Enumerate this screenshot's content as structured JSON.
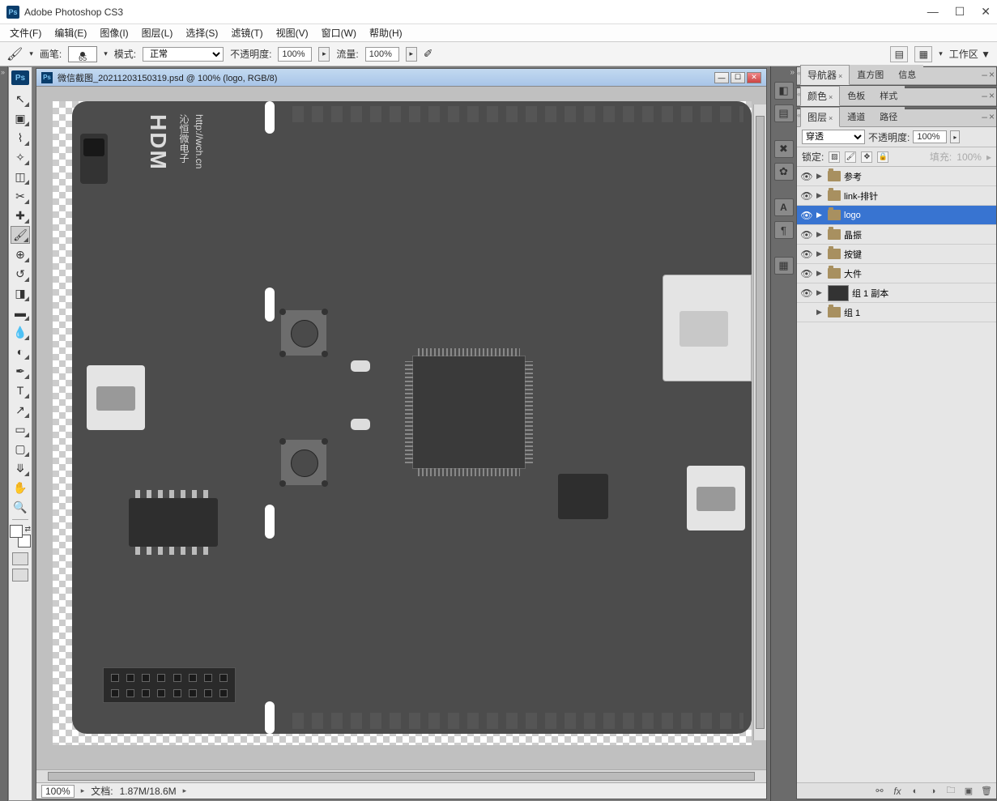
{
  "app": {
    "title": "Adobe Photoshop CS3"
  },
  "menus": [
    "文件(F)",
    "编辑(E)",
    "图像(I)",
    "图层(L)",
    "选择(S)",
    "滤镜(T)",
    "视图(V)",
    "窗口(W)",
    "帮助(H)"
  ],
  "options": {
    "brush_label": "画笔:",
    "brush_size": "65",
    "mode_label": "模式:",
    "mode_value": "正常",
    "opacity_label": "不透明度:",
    "opacity_value": "100%",
    "flow_label": "流量:",
    "flow_value": "100%",
    "workspace_label": "工作区 ▼"
  },
  "document": {
    "title": "微信截图_20211203150319.psd @ 100% (logo, RGB/8)",
    "zoom": "100%",
    "status_label": "文档:",
    "status_value": "1.87M/18.6M",
    "pcb_logo": "HDM",
    "pcb_sub": "沁恒微电子",
    "pcb_url": "http://wch.cn"
  },
  "nav_panel": {
    "tabs": [
      "导航器",
      "直方图",
      "信息"
    ]
  },
  "color_panel": {
    "tabs": [
      "颜色",
      "色板",
      "样式"
    ]
  },
  "layers_panel": {
    "tabs": [
      "图层",
      "通道",
      "路径"
    ],
    "blend_label": "",
    "blend_value": "穿透",
    "opacity_label": "不透明度:",
    "opacity_value": "100%",
    "lock_label": "锁定:",
    "fill_label": "填充:",
    "fill_value": "100%",
    "layers": [
      {
        "name": "参考",
        "type": "folder",
        "visible": true,
        "expanded": false,
        "selected": false
      },
      {
        "name": "link-排针",
        "type": "folder",
        "visible": true,
        "expanded": false,
        "selected": false
      },
      {
        "name": "logo",
        "type": "folder",
        "visible": true,
        "expanded": false,
        "selected": true
      },
      {
        "name": "晶振",
        "type": "folder",
        "visible": true,
        "expanded": false,
        "selected": false
      },
      {
        "name": "按键",
        "type": "folder",
        "visible": true,
        "expanded": false,
        "selected": false
      },
      {
        "name": "大件",
        "type": "folder",
        "visible": true,
        "expanded": false,
        "selected": false
      },
      {
        "name": "组 1 副本",
        "type": "layer",
        "visible": true,
        "expanded": false,
        "selected": false
      },
      {
        "name": "组 1",
        "type": "folder",
        "visible": false,
        "expanded": false,
        "selected": false
      }
    ]
  }
}
